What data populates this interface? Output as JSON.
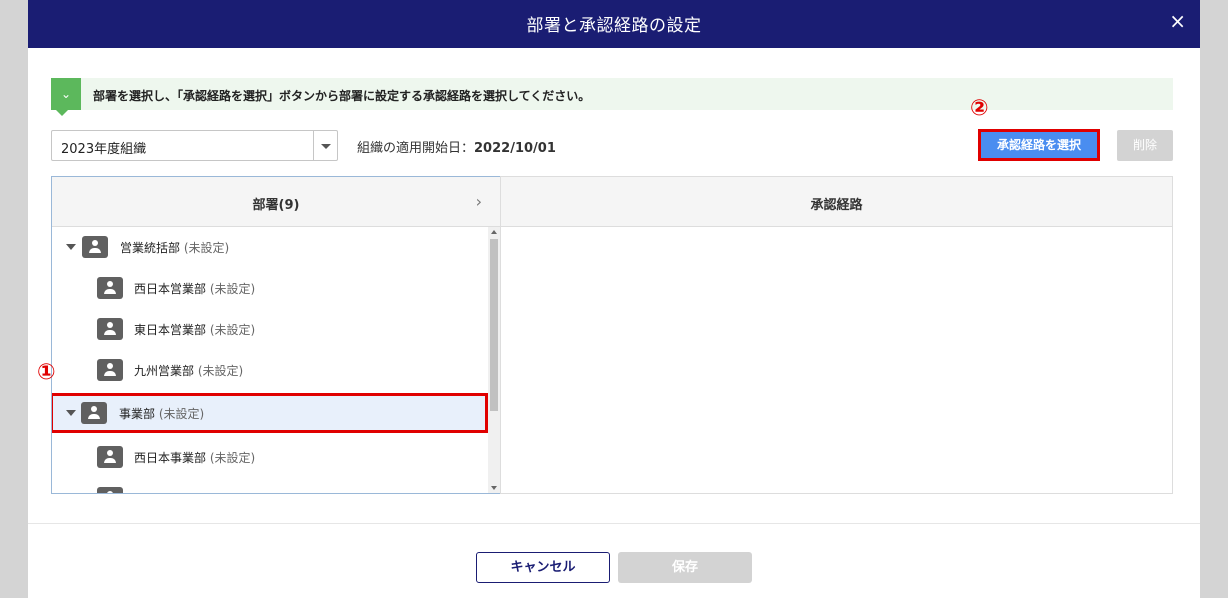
{
  "dialog": {
    "title": "部署と承認経路の設定",
    "close_icon": "×"
  },
  "info": {
    "badge_icon": "chevron-down-icon",
    "text": "部署を選択し、「承認経路を選択」ボタンから部署に設定する承認経路を選択してください。"
  },
  "org_select": {
    "value": "2023年度組織"
  },
  "date": {
    "label": "組織の適用開始日：",
    "value": "2022/10/01"
  },
  "actions": {
    "select_route": "承認経路を選択",
    "delete": "削除"
  },
  "markers": {
    "one": "①",
    "two": "②"
  },
  "departments": {
    "header": "部署(9)",
    "items": [
      {
        "name": "営業統括部",
        "status": "(未設定)"
      },
      {
        "name": "西日本営業部",
        "status": "(未設定)"
      },
      {
        "name": "東日本営業部",
        "status": "(未設定)"
      },
      {
        "name": "九州営業部",
        "status": "(未設定)"
      },
      {
        "name": "事業部",
        "status": "(未設定)"
      },
      {
        "name": "西日本事業部",
        "status": "(未設定)"
      }
    ]
  },
  "routes": {
    "header": "承認経路"
  },
  "footer": {
    "cancel": "キャンセル",
    "save": "保存"
  }
}
